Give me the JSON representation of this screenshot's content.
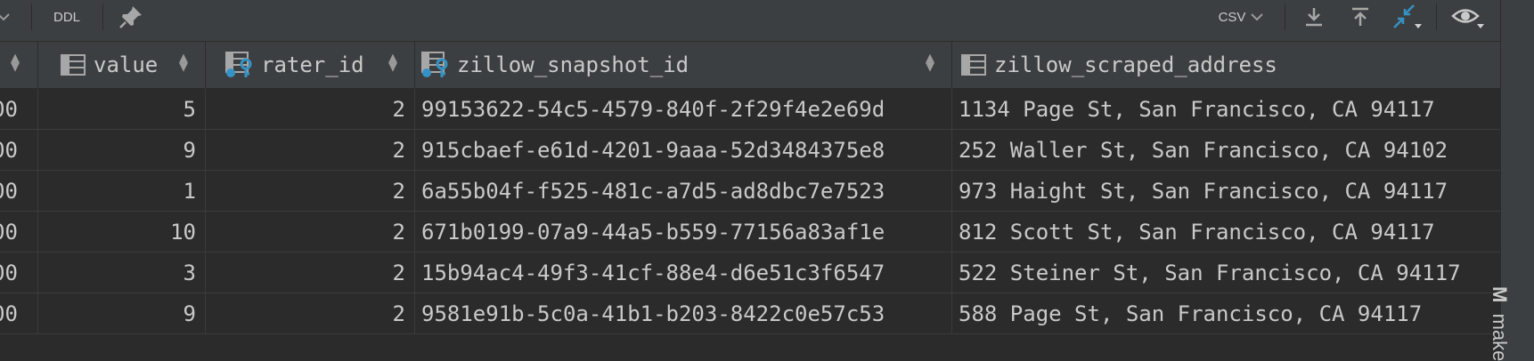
{
  "toolbar": {
    "ddl_label": "DDL",
    "export_format": "CSV",
    "icons": [
      "chevron-down-icon",
      "pin-icon",
      "download-icon",
      "upload-icon",
      "compare-icon",
      "eye-icon"
    ]
  },
  "columns": [
    {
      "name": "value",
      "icon": "column-icon"
    },
    {
      "name": "rater_id",
      "icon": "foreign-key-column-icon"
    },
    {
      "name": "zillow_snapshot_id",
      "icon": "foreign-key-column-icon"
    },
    {
      "name": "zillow_scraped_address",
      "icon": "column-icon"
    }
  ],
  "rows": [
    {
      "lead": "00",
      "value": "5",
      "rater_id": "2",
      "zillow_snapshot_id": "99153622-54c5-4579-840f-2f29f4e2e69d",
      "zillow_scraped_address": "1134 Page St, San Francisco, CA 94117"
    },
    {
      "lead": "00",
      "value": "9",
      "rater_id": "2",
      "zillow_snapshot_id": "915cbaef-e61d-4201-9aaa-52d3484375e8",
      "zillow_scraped_address": "252 Waller St, San Francisco, CA 94102"
    },
    {
      "lead": "00",
      "value": "1",
      "rater_id": "2",
      "zillow_snapshot_id": "6a55b04f-f525-481c-a7d5-ad8dbc7e7523",
      "zillow_scraped_address": "973 Haight St, San Francisco, CA 94117"
    },
    {
      "lead": "00",
      "value": "10",
      "rater_id": "2",
      "zillow_snapshot_id": "671b0199-07a9-44a5-b559-77156a83af1e",
      "zillow_scraped_address": "812 Scott St, San Francisco, CA 94117"
    },
    {
      "lead": "00",
      "value": "3",
      "rater_id": "2",
      "zillow_snapshot_id": "15b94ac4-49f3-41cf-88e4-d6e51c3f6547",
      "zillow_scraped_address": "522 Steiner St, San Francisco, CA 94117"
    },
    {
      "lead": "00",
      "value": "9",
      "rater_id": "2",
      "zillow_snapshot_id": "9581e91b-5c0a-41b1-b203-8422c0e57c53",
      "zillow_scraped_address": "588 Page St, San Francisco, CA 94117"
    }
  ],
  "side_panel": {
    "label": "M",
    "label2": "make"
  },
  "colors": {
    "background": "#2b2b2b",
    "toolbar": "#3c3f41",
    "accent": "#3592c4",
    "text": "#c9c9c9"
  }
}
